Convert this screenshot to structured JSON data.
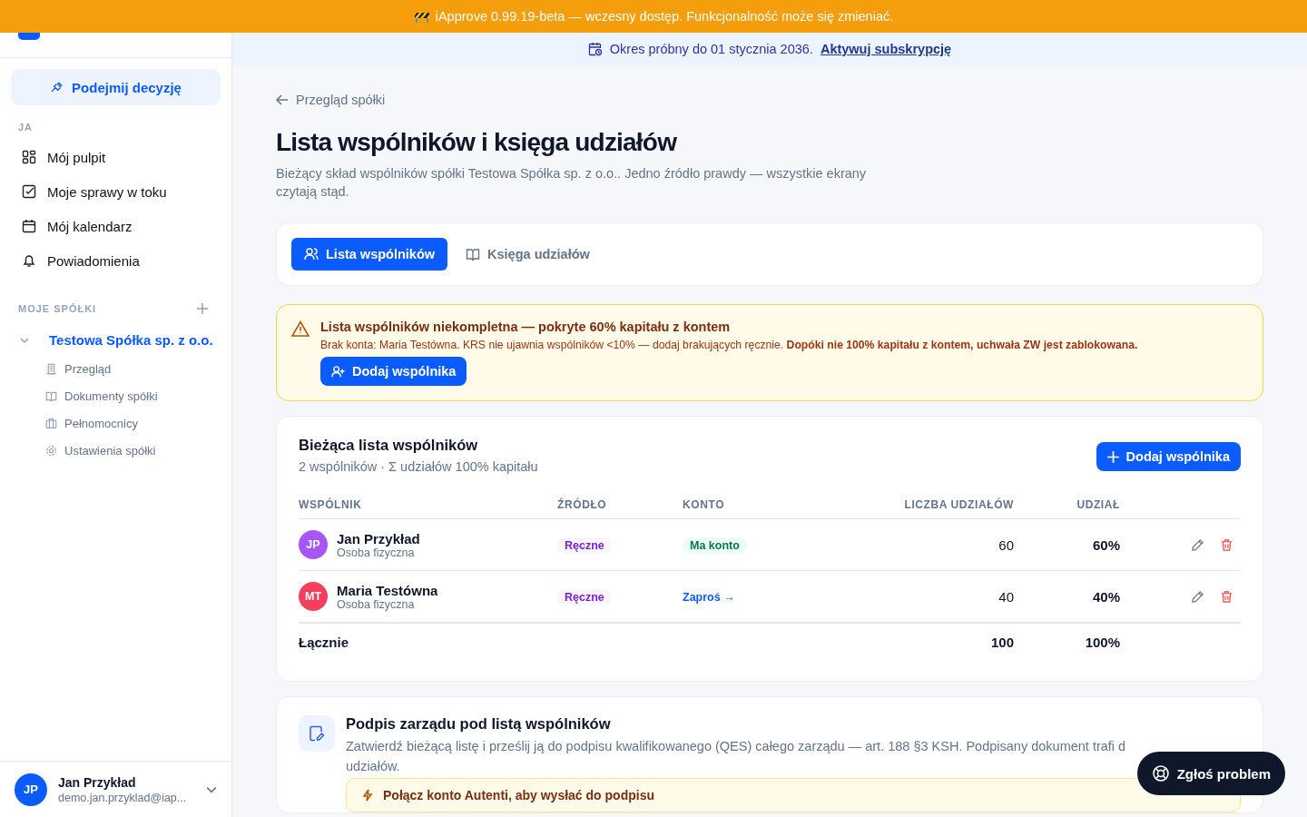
{
  "beta_banner": {
    "text": "iApprove 0.99.19-beta — wczesny dostęp. Funkcjonalność może się zmieniać."
  },
  "trial_bar": {
    "text": "Okres próbny do 01 stycznia 2036.",
    "link": "Aktywuj subskrypcję"
  },
  "sidebar": {
    "decision_button": "Podejmij decyzję",
    "section_me": "JA",
    "items": [
      {
        "label": "Mój pulpit"
      },
      {
        "label": "Moje sprawy w toku"
      },
      {
        "label": "Mój kalendarz"
      },
      {
        "label": "Powiadomienia"
      }
    ],
    "section_companies": "MOJE SPÓŁKI",
    "company": {
      "name": "Testowa Spółka sp. z o.o.",
      "expanded": true,
      "children": [
        {
          "label": "Przegląd"
        },
        {
          "label": "Dokumenty spółki"
        },
        {
          "label": "Pełnomocnicy"
        },
        {
          "label": "Ustawienia spółki"
        }
      ]
    },
    "user": {
      "initials": "JP",
      "name": "Jan Przykład",
      "email": "demo.jan.przyklad@iap..."
    }
  },
  "page": {
    "back_link": "Przegląd spółki",
    "title": "Lista wspólników i księga udziałów",
    "subtitle": "Bieżący skład wspólników spółki Testowa Spółka sp. z o.o.. Jedno źródło prawdy — wszystkie ekrany czytają stąd.",
    "tabs": [
      {
        "label": "Lista wspólników",
        "selected": true
      },
      {
        "label": "Księga udziałów",
        "selected": false
      }
    ],
    "warning": {
      "title": "Lista wspólników niekompletna — pokryte 60% kapitału z kontem",
      "text": "Brak konta: Maria Testówna. KRS nie ujawnia wspólników <10% — dodaj brakujących ręcznie. **Dopóki nie 100% kapitału z kontem, uchwała ZW jest zablokowana.**",
      "button": "Dodaj wspólnika"
    },
    "partners": {
      "title": "Bieżąca lista wspólników",
      "summary": "2 wspólników · Σ udziałów 100% kapitału",
      "button": "Dodaj wspólnika",
      "columns": [
        "WSPÓLNIK",
        "ŹRÓDŁO",
        "KONTO",
        "LICZBA UDZIAŁÓW",
        "UDZIAŁ"
      ],
      "rows": [
        {
          "initials": "JP",
          "color": "#a855f7",
          "name": "Jan Przykład",
          "type": "Osoba fizyczna",
          "source": "Ręczne",
          "account": {
            "kind": "badge",
            "text": "Ma konto"
          },
          "shares": "60",
          "percent": "60%"
        },
        {
          "initials": "MT",
          "color": "#f43f5e",
          "name": "Maria Testówna",
          "type": "Osoba fizyczna",
          "source": "Ręczne",
          "account": {
            "kind": "link",
            "text": "Zaproś →"
          },
          "shares": "40",
          "percent": "40%"
        }
      ],
      "total": {
        "label": "Łącznie",
        "shares": "100",
        "percent": "100%"
      }
    },
    "signature": {
      "title": "Podpis zarządu pod listą wspólników",
      "description_line_1": "Zatwierdź bieżącą listę i prześlij ją do podpisu kwalifikowanego (QES) całego zarządu — art. 188 §3 KSH. Podpisany dokument trafi d",
      "description_line_2": "udziałów.",
      "notice": "Połącz konto Autenti, aby wysłać do podpisu"
    }
  },
  "help_button": "Zgłoś problem"
}
